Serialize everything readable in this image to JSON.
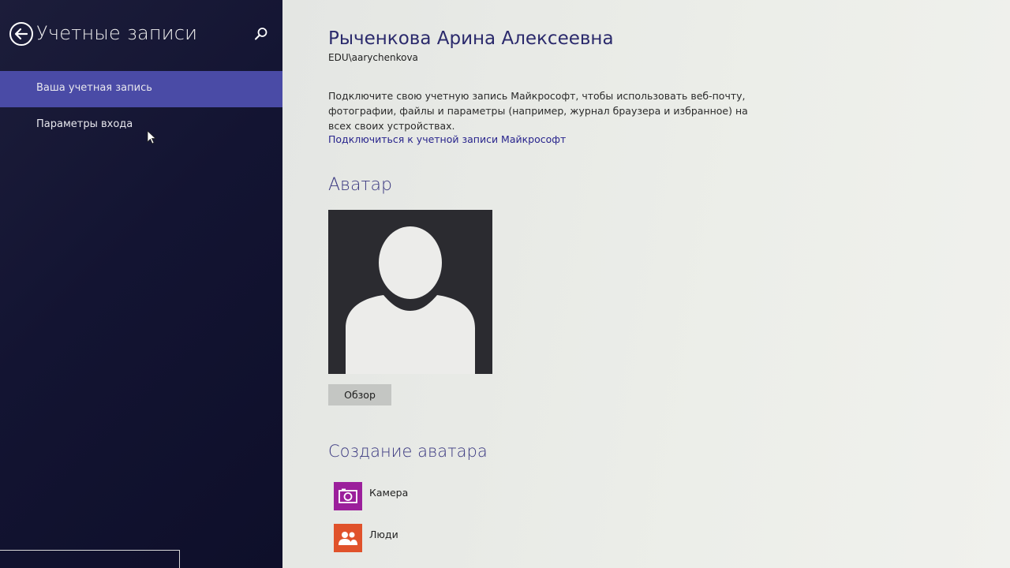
{
  "sidebar": {
    "title": "Учетные записи",
    "items": [
      {
        "label": "Ваша учетная запись",
        "selected": true
      },
      {
        "label": "Параметры входа",
        "selected": false
      }
    ],
    "back_icon": "back-arrow-circle-icon",
    "search_icon": "search-icon"
  },
  "account": {
    "name": "Рыченкова Арина Алексеевна",
    "login": "EDU\\aarychenkova",
    "description": "Подключите свою учетную запись Майкрософт, чтобы использовать веб-почту, фотографии, файлы и параметры (например, журнал браузера и избранное) на всех своих устройствах.",
    "connect_link": "Подключиться к учетной записи Майкрософт"
  },
  "avatar_section": {
    "title": "Аватар",
    "browse_label": "Обзор"
  },
  "create_section": {
    "title": "Создание аватара",
    "apps": [
      {
        "label": "Камера",
        "icon": "camera-icon",
        "color": "#9b1f9b"
      },
      {
        "label": "Люди",
        "icon": "people-icon",
        "color": "#e0522b"
      }
    ]
  },
  "colors": {
    "sidebar_bg": "#131432",
    "selected_item": "#4a4ba6",
    "accent_text": "#2b2a6c",
    "link": "#27238c"
  }
}
